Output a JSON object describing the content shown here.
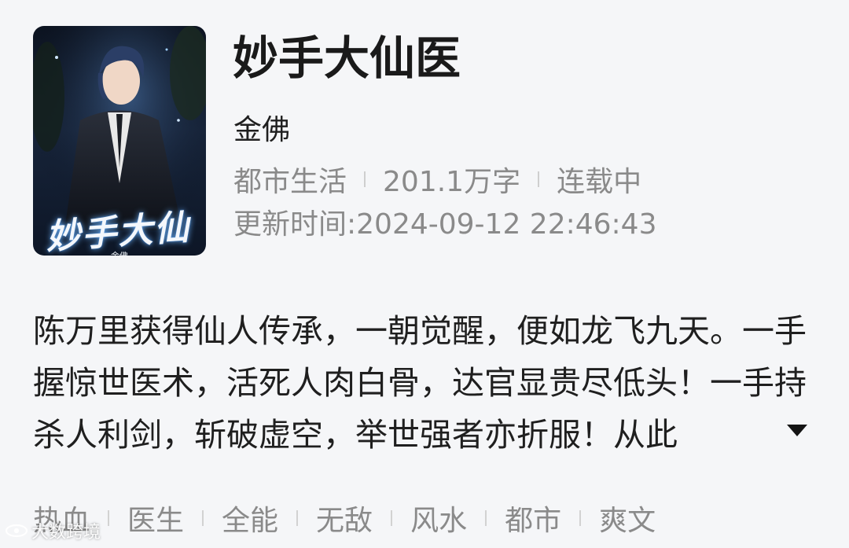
{
  "book": {
    "title": "妙手大仙医",
    "author": "金佛",
    "category": "都市生活",
    "word_count": "201.1万字",
    "status": "连载中",
    "update_label": "更新时间:",
    "update_time": "2024-09-12 22:46:43",
    "synopsis": "陈万里获得仙人传承，一朝觉醒，便如龙飞九天。一手握惊世医术，活死人肉白骨，达官显贵尽低头！一手持杀人利剑，斩破虚空，举世强者亦折服！从此"
  },
  "cover": {
    "title_art": "妙手大仙医",
    "author_art": "金佛"
  },
  "tags": [
    "热血",
    "医生",
    "全能",
    "无敌",
    "风水",
    "都市",
    "爽文"
  ],
  "icons": {
    "expand": "caret-down-icon",
    "watermark": "eye-logo-icon"
  },
  "watermark": {
    "text": "大数跨境"
  },
  "colors": {
    "background": "#f5f6f8",
    "title": "#1a1a1a",
    "secondary_text": "#8a8a8a"
  }
}
